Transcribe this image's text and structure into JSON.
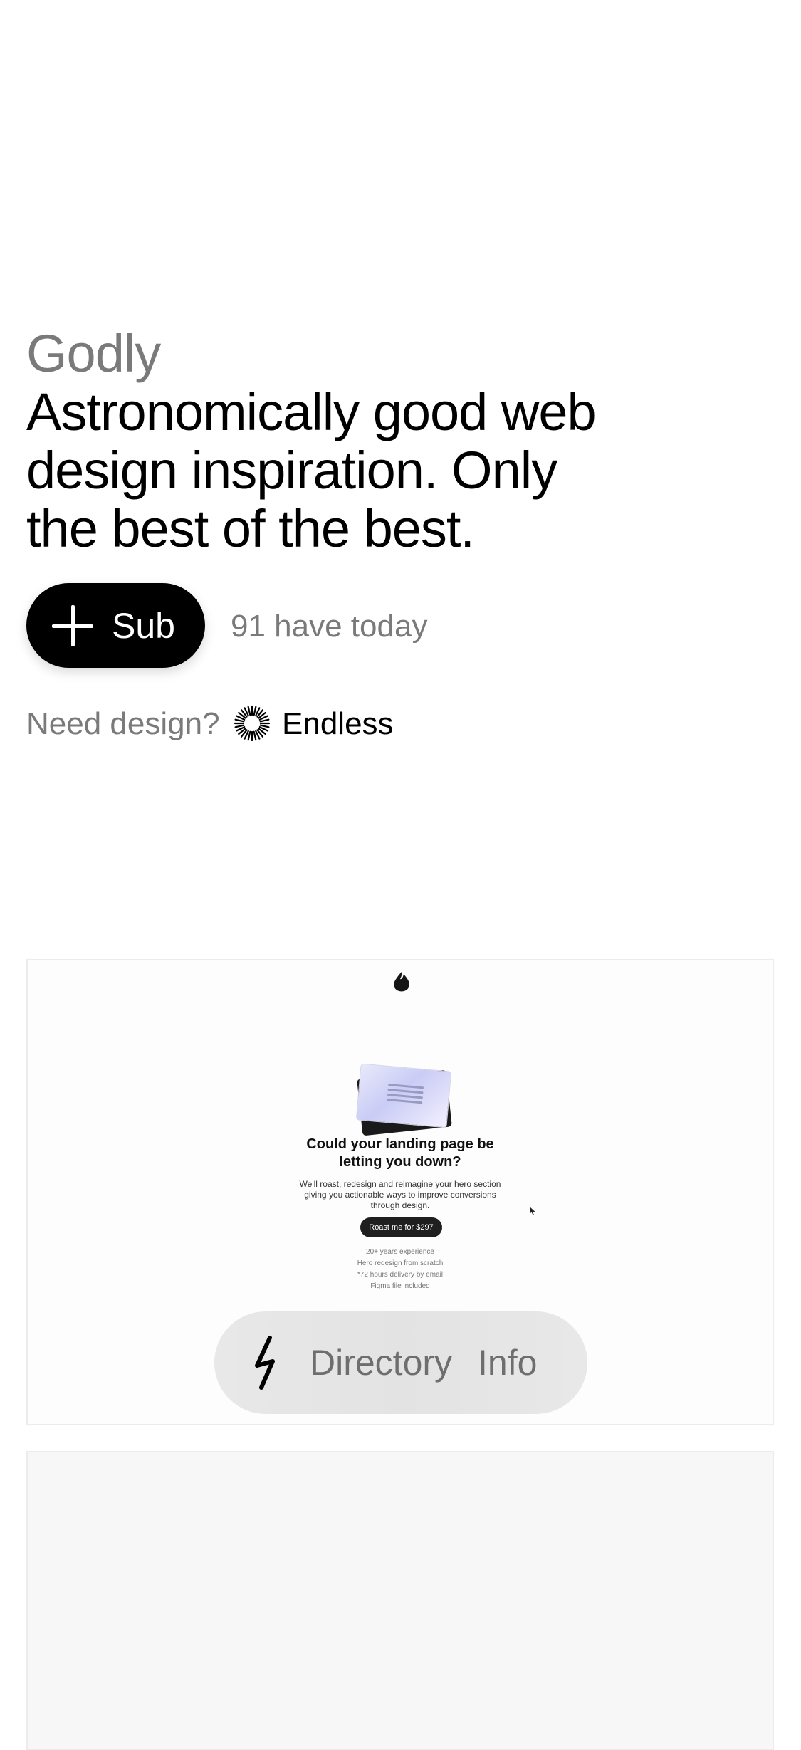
{
  "brand": {
    "name": "Godly"
  },
  "hero": {
    "headline_lines": [
      "Astronomically good web",
      "design inspiration. Only",
      "the best of the best."
    ]
  },
  "subscribe": {
    "label": "Sub",
    "count_text": "91 have today"
  },
  "design_cta": {
    "prompt": "Need design?",
    "partner": "Endless"
  },
  "featured_site": {
    "title_lines": [
      "Could your landing page be",
      "letting you down?"
    ],
    "description_lines": [
      "We'll roast, redesign and reimagine your hero section",
      "giving you actionable ways to improve conversions",
      "through design."
    ],
    "cta_label": "Roast me for $297",
    "features": [
      "20+ years experience",
      "Hero redesign from scratch",
      "*72 hours delivery by email",
      "Figma file included"
    ]
  },
  "bottom_nav": {
    "icon": "lightning-bolt-icon",
    "items": [
      "Directory",
      "Info"
    ]
  },
  "colors": {
    "accent": "#000000",
    "muted_text": "#7a7a7a",
    "nav_background": "#e5e5e5"
  }
}
